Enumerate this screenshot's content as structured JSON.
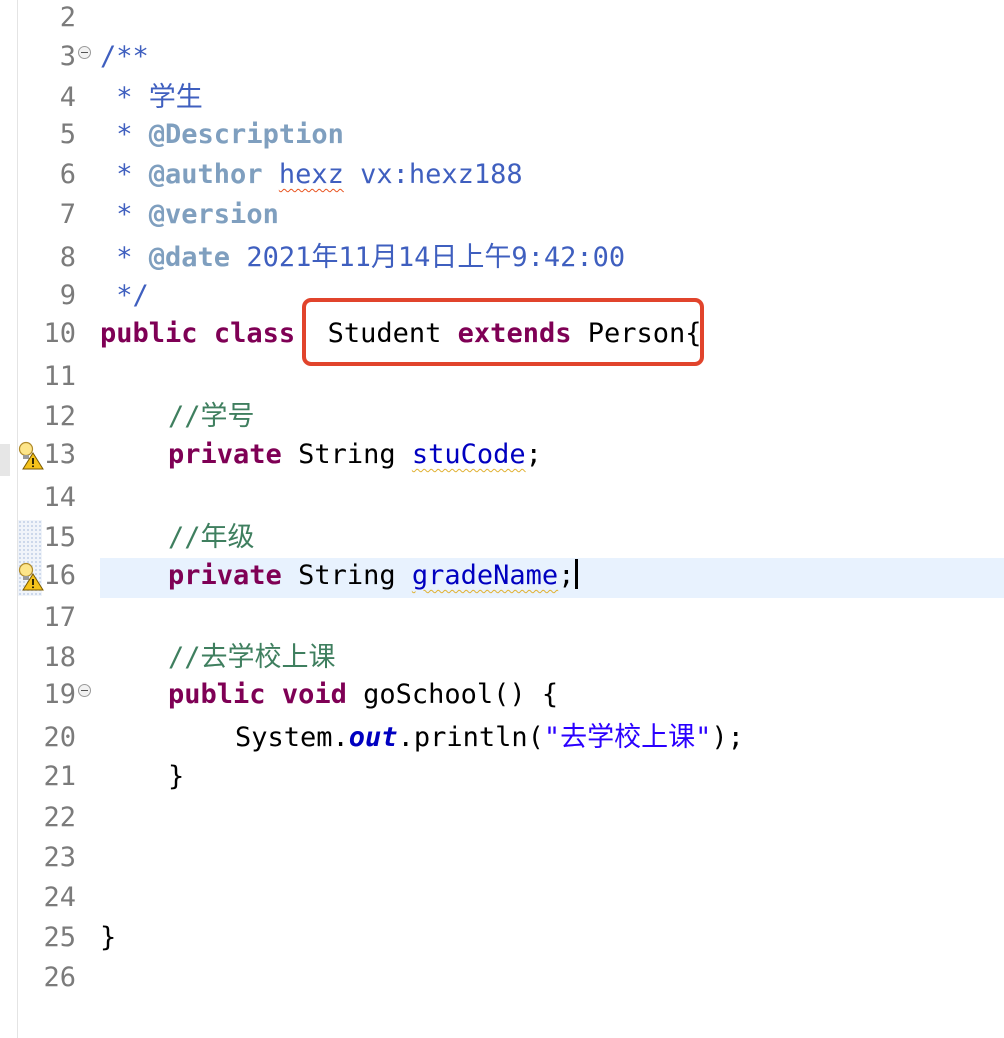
{
  "editor": {
    "line_numbers": [
      "2",
      "3",
      "4",
      "5",
      "6",
      "7",
      "8",
      "9",
      "10",
      "11",
      "12",
      "13",
      "14",
      "15",
      "16",
      "17",
      "18",
      "19",
      "20",
      "21",
      "22",
      "23",
      "24",
      "25",
      "26"
    ],
    "code": {
      "l3_doc_open": "/**",
      "l4_star": " * ",
      "l4_text": "学生",
      "l5_star": " * ",
      "l5_tag": "@Description",
      "l6_star": " * ",
      "l6_tag": "@author",
      "l6_name": "hexz",
      "l6_rest": " vx:hexz188",
      "l7_star": " * ",
      "l7_tag": "@version",
      "l8_star": " * ",
      "l8_tag": "@date",
      "l8_rest": " 2021年11月14日上午9:42:00",
      "l9_doc_close": " */",
      "l10_kw_public": "public",
      "l10_kw_class": "class",
      "l10_classname": "Student",
      "l10_kw_extends": "extends",
      "l10_parent": "Person{",
      "l12_comment": "//学号",
      "l13_kw_private": "private",
      "l13_type": "String",
      "l13_field": "stuCode",
      "l13_semicolon": ";",
      "l15_comment": "//年级",
      "l16_kw_private": "private",
      "l16_type": "String",
      "l16_field": "gradeName",
      "l16_semicolon": ";",
      "l18_comment": "//去学校上课",
      "l19_kw_public": "public",
      "l19_kw_void": "void",
      "l19_method": "goSchool() {",
      "l20_system": "System.",
      "l20_out": "out",
      "l20_println": ".println(",
      "l20_string": "\"去学校上课\"",
      "l20_close": ");",
      "l21_close": "}",
      "l25_close": "}"
    },
    "icons": {
      "fold": "collapse-toggle-icon",
      "warning": "lightbulb-warning-icon"
    },
    "colors": {
      "keyword": "#7f0055",
      "javadoc": "#3f5fbf",
      "javadoc_tag": "#7f9fbf",
      "comment": "#3f7f5f",
      "field": "#0000c0",
      "string": "#2a00ff",
      "current_line": "#e8f2fe",
      "annotation_box": "#e1442c"
    }
  }
}
